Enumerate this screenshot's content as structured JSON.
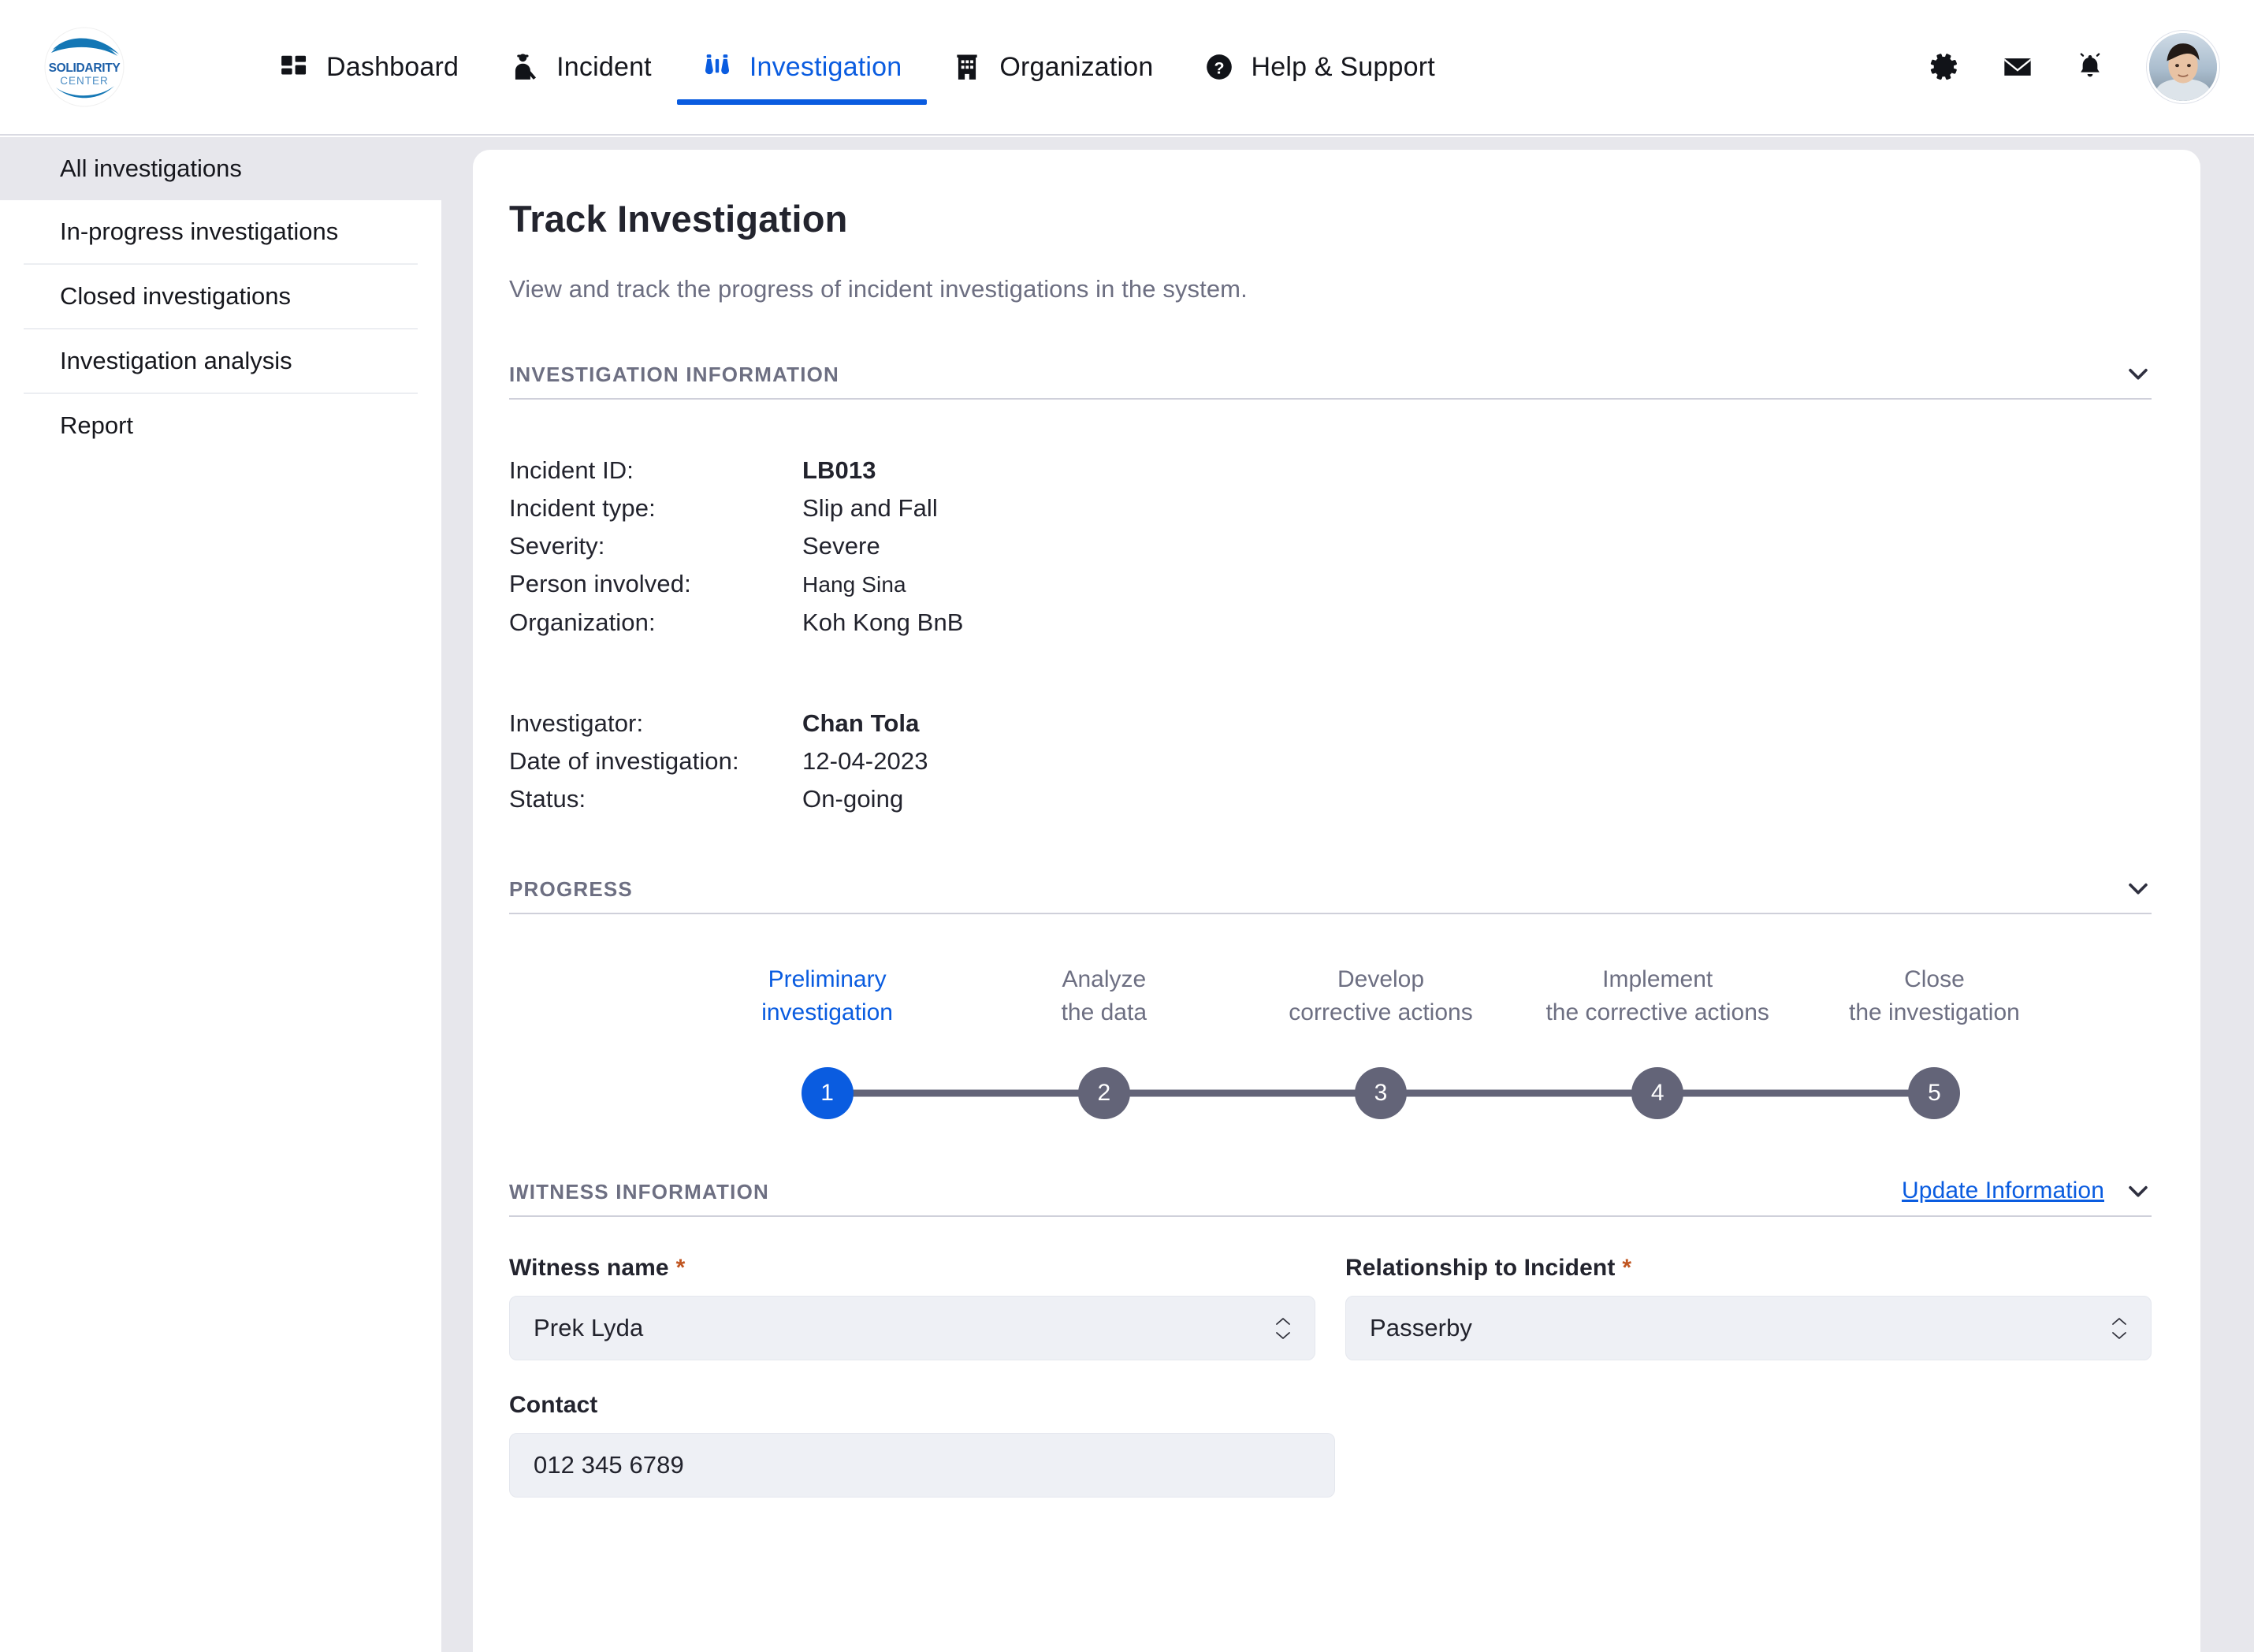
{
  "brand": {
    "logo_line1": "SOLIDARITY",
    "logo_line2": "CENTER"
  },
  "topnav": {
    "items": [
      {
        "label": "Dashboard",
        "icon": "dashboard-icon",
        "active": false
      },
      {
        "label": "Incident",
        "icon": "incident-person-icon",
        "active": false
      },
      {
        "label": "Investigation",
        "icon": "binoculars-icon",
        "active": true
      },
      {
        "label": "Organization",
        "icon": "building-icon",
        "active": false
      },
      {
        "label": "Help & Support",
        "icon": "question-circle-icon",
        "active": false
      }
    ],
    "actions": [
      {
        "name": "settings",
        "icon": "gear-icon"
      },
      {
        "name": "messages",
        "icon": "envelope-icon"
      },
      {
        "name": "notifications",
        "icon": "bell-icon"
      }
    ]
  },
  "sidebar": {
    "items": [
      {
        "label": "All investigations",
        "active": true
      },
      {
        "label": "In-progress investigations",
        "active": false
      },
      {
        "label": "Closed investigations",
        "active": false
      },
      {
        "label": "Investigation analysis",
        "active": false
      },
      {
        "label": "Report",
        "active": false
      }
    ]
  },
  "main": {
    "title": "Track Investigation",
    "subtitle": "View and track the progress of incident investigations in the system."
  },
  "investigation_information": {
    "section_title": "INVESTIGATION INFORMATION",
    "rows_primary": [
      {
        "label": "Incident ID:",
        "value": "LB013",
        "style": "bold"
      },
      {
        "label": "Incident type:",
        "value": "Slip and Fall",
        "style": "normal"
      },
      {
        "label": "Severity:",
        "value": "Severe",
        "style": "normal"
      },
      {
        "label": "Person involved:",
        "value": "Hang Sina",
        "style": "small"
      },
      {
        "label": "Organization:",
        "value": "Koh Kong BnB",
        "style": "normal"
      }
    ],
    "rows_secondary": [
      {
        "label": "Investigator:",
        "value": "Chan Tola",
        "style": "bold"
      },
      {
        "label": "Date of investigation:",
        "value": "12-04-2023",
        "style": "normal"
      },
      {
        "label": "Status:",
        "value": "On-going",
        "style": "normal"
      }
    ]
  },
  "progress": {
    "section_title": "PROGRESS",
    "current_step": 1,
    "steps": [
      {
        "number": "1",
        "line1": "Preliminary",
        "line2": "investigation",
        "active": true
      },
      {
        "number": "2",
        "line1": "Analyze",
        "line2": "the data",
        "active": false
      },
      {
        "number": "3",
        "line1": "Develop",
        "line2": "corrective actions",
        "active": false
      },
      {
        "number": "4",
        "line1": "Implement",
        "line2": "the corrective actions",
        "active": false
      },
      {
        "number": "5",
        "line1": "Close",
        "line2": "the investigation",
        "active": false
      }
    ]
  },
  "witness_information": {
    "section_title": "WITNESS INFORMATION",
    "update_link": "Update Information",
    "fields": {
      "witness_name": {
        "label": "Witness name",
        "required": "*",
        "value": "Prek Lyda"
      },
      "relationship": {
        "label": "Relationship to Incident",
        "required": "*",
        "value": "Passerby"
      },
      "contact": {
        "label": "Contact",
        "required": "",
        "value": "012 345 6789"
      }
    }
  },
  "colors": {
    "accent_blue": "#0a5ce0",
    "step_gray": "#636478",
    "muted_text": "#6d6f82",
    "panel_bg": "#e7e7ec",
    "field_bg": "#eef0f5",
    "required_orange": "#c05621"
  }
}
